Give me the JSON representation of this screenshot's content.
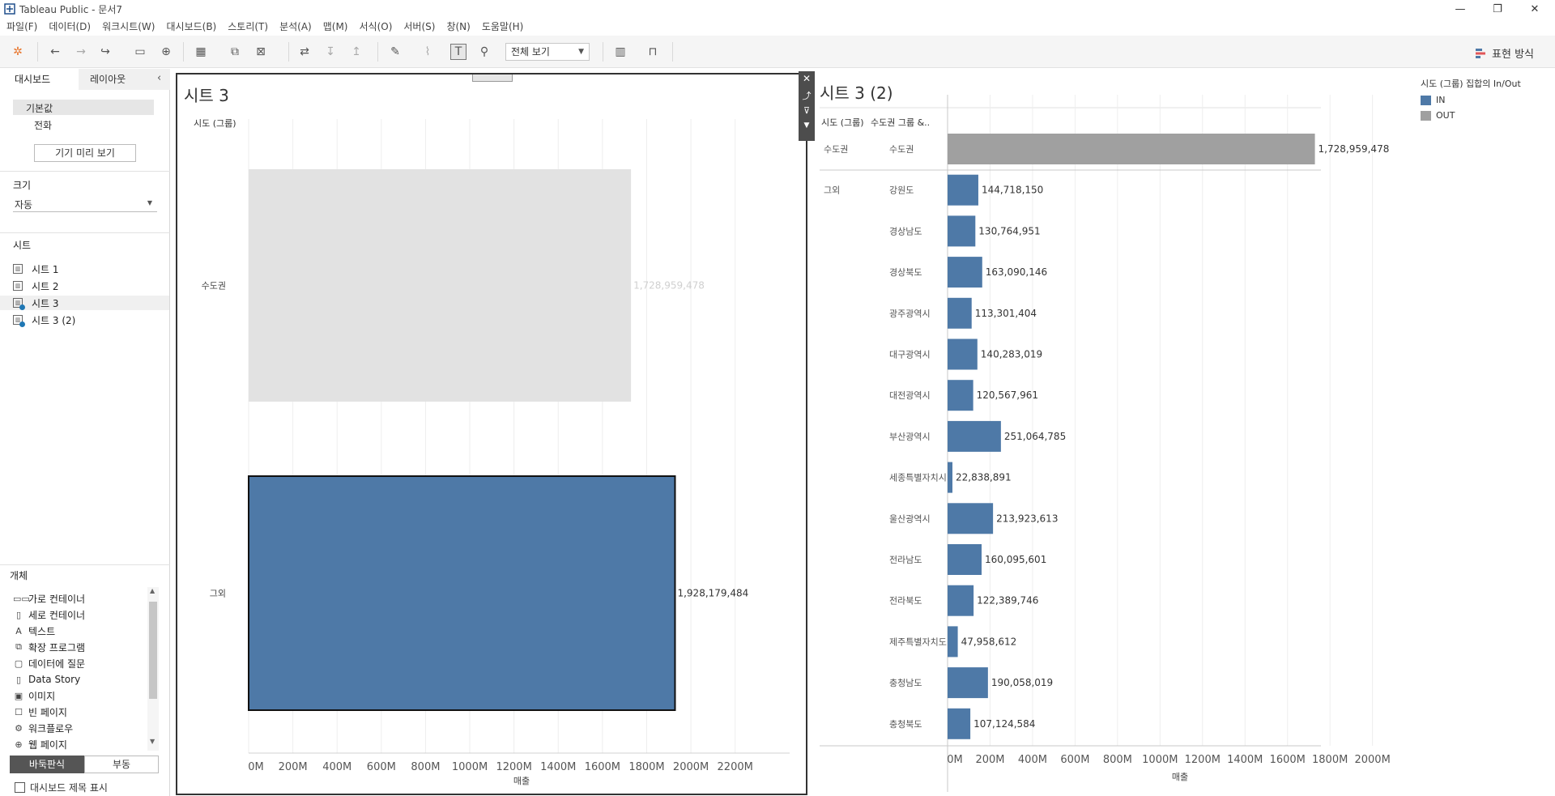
{
  "window": {
    "title": "Tableau Public - 문서7"
  },
  "menu": [
    "파일(F)",
    "데이터(D)",
    "워크시트(W)",
    "대시보드(B)",
    "스토리(T)",
    "분석(A)",
    "맵(M)",
    "서식(O)",
    "서버(S)",
    "창(N)",
    "도움말(H)"
  ],
  "toolbar": {
    "fit_value": "전체 보기",
    "show_me": "표현 방식"
  },
  "left": {
    "tab_dashboard": "대시보드",
    "tab_layout": "레이아웃",
    "device_default": "기본값",
    "device_phone": "전화",
    "device_preview": "기기 미리 보기",
    "size_header": "크기",
    "size_value": "자동",
    "sheets_header": "시트",
    "sheets": [
      "시트 1",
      "시트 2",
      "시트 3",
      "시트 3 (2)"
    ],
    "objects_header": "개체",
    "objects": [
      "가로 컨테이너",
      "세로 컨테이너",
      "텍스트",
      "확장 프로그램",
      "데이터에 질문",
      "Data Story",
      "이미지",
      "빈 페이지",
      "워크플로우",
      "웹 페이지"
    ],
    "tiled": "바둑판식",
    "floating": "부동",
    "show_title": "대시보드 제목 표시"
  },
  "colors": {
    "in": "#4e79a7",
    "out": "#a0a0a0",
    "out_light": "#e2e2e2"
  },
  "sheet3": {
    "title": "시트 3",
    "row_header": "시도 (그룹)",
    "axis_title": "매출",
    "ticks": [
      "0M",
      "200M",
      "400M",
      "600M",
      "800M",
      "1000M",
      "1200M",
      "1400M",
      "1600M",
      "1800M",
      "2000M",
      "2200M"
    ]
  },
  "sheet3_2": {
    "title": "시트 3 (2)",
    "row_header1": "시도 (그룹)",
    "row_header2": "수도권 그룹 &..",
    "axis_title": "매출",
    "ticks": [
      "0M",
      "200M",
      "400M",
      "600M",
      "800M",
      "1000M",
      "1200M",
      "1400M",
      "1600M",
      "1800M",
      "2000M"
    ]
  },
  "legend": {
    "title": "시도 (그룹) 집합의 In/Out",
    "items": [
      "IN",
      "OUT"
    ]
  },
  "chart_data": [
    {
      "type": "bar",
      "title": "시트 3",
      "categories": [
        "수도권",
        "그외"
      ],
      "values": [
        1728959478,
        1928179484
      ],
      "value_labels": [
        "1,728,959,478",
        "1,928,179,484"
      ],
      "set": [
        "OUT",
        "IN"
      ],
      "xlabel": "매출",
      "ylabel": "시도 (그룹)",
      "xlim": [
        0,
        2300000000
      ]
    },
    {
      "type": "bar",
      "title": "시트 3 (2)",
      "groups": [
        "수도권",
        "그외",
        "그외",
        "그외",
        "그외",
        "그외",
        "그외",
        "그외",
        "그외",
        "그외",
        "그외",
        "그외",
        "그외",
        "그외",
        "그외"
      ],
      "categories": [
        "수도권",
        "강원도",
        "경상남도",
        "경상북도",
        "광주광역시",
        "대구광역시",
        "대전광역시",
        "부산광역시",
        "세종특별자치시",
        "울산광역시",
        "전라남도",
        "전라북도",
        "제주특별자치도",
        "충청남도",
        "충청북도"
      ],
      "values": [
        1728959478,
        144718150,
        130764951,
        163090146,
        113301404,
        140283019,
        120567961,
        251064785,
        22838891,
        213923613,
        160095601,
        122389746,
        47958612,
        190058019,
        107124584
      ],
      "value_labels": [
        "1,728,959,478",
        "144,718,150",
        "130,764,951",
        "163,090,146",
        "113,301,404",
        "140,283,019",
        "120,567,961",
        "251,064,785",
        "22,838,891",
        "213,923,613",
        "160,095,601",
        "122,389,746",
        "47,958,612",
        "190,058,019",
        "107,124,584"
      ],
      "set": [
        "OUT",
        "IN",
        "IN",
        "IN",
        "IN",
        "IN",
        "IN",
        "IN",
        "IN",
        "IN",
        "IN",
        "IN",
        "IN",
        "IN",
        "IN"
      ],
      "xlabel": "매출",
      "xlim": [
        0,
        2150000000
      ]
    }
  ]
}
